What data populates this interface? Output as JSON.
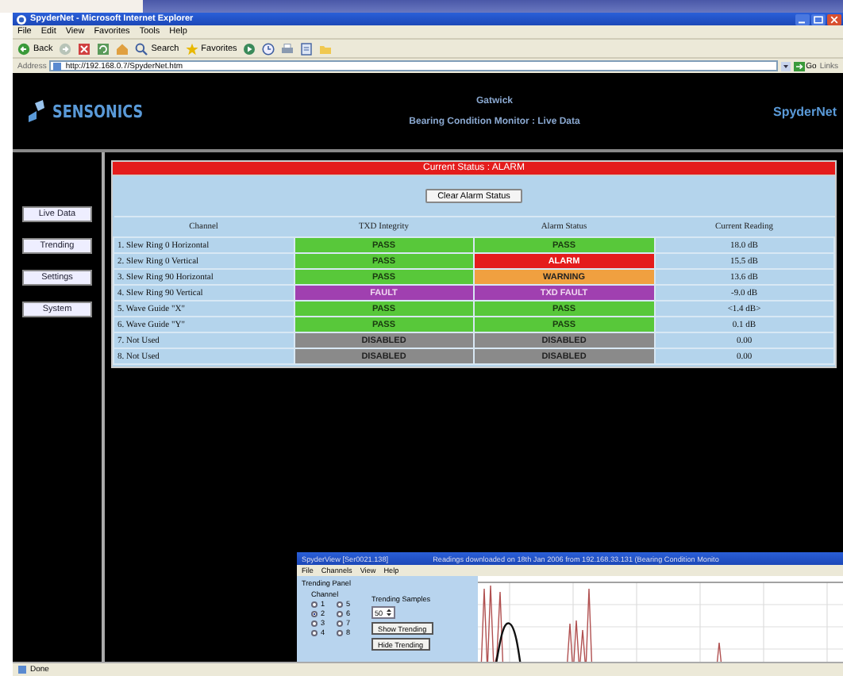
{
  "browser": {
    "title": "SpyderNet - Microsoft Internet Explorer",
    "menu": [
      "File",
      "Edit",
      "View",
      "Favorites",
      "Tools",
      "Help"
    ],
    "toolbar": [
      {
        "kind": "back",
        "label": "Back"
      },
      {
        "kind": "forward"
      },
      {
        "kind": "stop"
      },
      {
        "kind": "refresh"
      },
      {
        "kind": "home"
      },
      {
        "kind": "search",
        "label": "Search"
      },
      {
        "kind": "favorites",
        "label": "Favorites"
      },
      {
        "kind": "media"
      },
      {
        "kind": "history"
      },
      {
        "kind": "print"
      },
      {
        "kind": "edit"
      },
      {
        "kind": "folder"
      }
    ],
    "address": {
      "label": "Address",
      "value": "http://192.168.0.7/SpyderNet.htm",
      "go": "Go",
      "links": "Links"
    },
    "status": "Done"
  },
  "header": {
    "brand": "SENSONICS",
    "site": "Gatwick",
    "subtitle": "Bearing Condition Monitor : Live Data",
    "product": "SpyderNet"
  },
  "nav": [
    {
      "label": "Live Data"
    },
    {
      "label": "Trending"
    },
    {
      "label": "Settings"
    },
    {
      "label": "System"
    }
  ],
  "status_banner": {
    "text": "Current Status : ALARM",
    "kind": "alarm"
  },
  "clear_button": "Clear Alarm Status",
  "table": {
    "columns": [
      "Channel",
      "TXD Integrity",
      "Alarm Status",
      "Current Reading"
    ],
    "rows": [
      {
        "channel": "1.  Slew Ring 0 Horizontal",
        "txd": {
          "text": "PASS",
          "kind": "pass"
        },
        "alarm": {
          "text": "PASS",
          "kind": "pass"
        },
        "reading": "18.0 dB"
      },
      {
        "channel": "2.  Slew Ring 0 Vertical",
        "txd": {
          "text": "PASS",
          "kind": "pass"
        },
        "alarm": {
          "text": "ALARM",
          "kind": "alarm"
        },
        "reading": "15.5 dB"
      },
      {
        "channel": "3.  Slew Ring 90 Horizontal",
        "txd": {
          "text": "PASS",
          "kind": "pass"
        },
        "alarm": {
          "text": "WARNING",
          "kind": "warning"
        },
        "reading": "13.6 dB"
      },
      {
        "channel": "4.  Slew Ring 90 Vertical",
        "txd": {
          "text": "FAULT",
          "kind": "fault"
        },
        "alarm": {
          "text": "TXD FAULT",
          "kind": "fault"
        },
        "reading": "-9.0 dB"
      },
      {
        "channel": "5.  Wave Guide \"X\"",
        "txd": {
          "text": "PASS",
          "kind": "pass"
        },
        "alarm": {
          "text": "PASS",
          "kind": "pass"
        },
        "reading": "<1.4 dB>"
      },
      {
        "channel": "6.  Wave Guide \"Y\"",
        "txd": {
          "text": "PASS",
          "kind": "pass"
        },
        "alarm": {
          "text": "PASS",
          "kind": "pass"
        },
        "reading": "0.1 dB"
      },
      {
        "channel": "7.  Not Used",
        "txd": {
          "text": "DISABLED",
          "kind": "disabled"
        },
        "alarm": {
          "text": "DISABLED",
          "kind": "disabled"
        },
        "reading": "0.00"
      },
      {
        "channel": "8.  Not Used",
        "txd": {
          "text": "DISABLED",
          "kind": "disabled"
        },
        "alarm": {
          "text": "DISABLED",
          "kind": "disabled"
        },
        "reading": "0.00"
      }
    ]
  },
  "overlay": {
    "title": "SpyderView [Ser0021.138]",
    "info": "Readings downloaded on 18th Jan 2006 from 192.168.33.131 (Bearing Condition Monito",
    "menu": [
      "File",
      "Channels",
      "View",
      "Help"
    ],
    "panel_title": "Trending Panel",
    "channel_label": "Channel",
    "channels": [
      {
        "label": "1",
        "selected": false
      },
      {
        "label": "2",
        "selected": true
      },
      {
        "label": "3",
        "selected": false
      },
      {
        "label": "4",
        "selected": false
      },
      {
        "label": "5",
        "selected": false
      },
      {
        "label": "6",
        "selected": false
      },
      {
        "label": "7",
        "selected": false
      },
      {
        "label": "8",
        "selected": false
      }
    ],
    "samples_label": "Trending Samples",
    "samples": "50",
    "buttons": [
      "Show Trending",
      "Hide Trending"
    ]
  }
}
